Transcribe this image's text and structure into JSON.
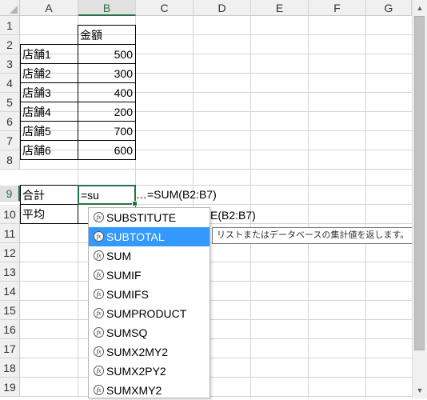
{
  "columns": [
    "A",
    "B",
    "C",
    "D",
    "E",
    "F",
    "G"
  ],
  "rows": [
    "1",
    "2",
    "3",
    "4",
    "5",
    "6",
    "7",
    "8",
    "9",
    "10",
    "11",
    "12",
    "13",
    "14",
    "15",
    "16",
    "17",
    "18",
    "19"
  ],
  "cells": {
    "B1": "金額",
    "A2": "店舗1",
    "B2": "500",
    "A3": "店舗2",
    "B3": "300",
    "A4": "店舗3",
    "B4": "400",
    "A5": "店舗4",
    "B5": "200",
    "A6": "店舗5",
    "B6": "700",
    "A7": "店舗6",
    "B7": "600",
    "A9": "合計",
    "B9": "=su",
    "C9": "…=SUM(B2:B7)",
    "A10": "平均",
    "C10_visible": "E(B2:B7)"
  },
  "autocomplete": {
    "items": [
      "SUBSTITUTE",
      "SUBTOTAL",
      "SUM",
      "SUMIF",
      "SUMIFS",
      "SUMPRODUCT",
      "SUMSQ",
      "SUMX2MY2",
      "SUMX2PY2",
      "SUMXMY2"
    ],
    "selected_index": 1,
    "tooltip": "リストまたはデータベースの集計値を返します。"
  },
  "icons": {
    "function": "fx-icon",
    "scroll_up": "▲",
    "scroll_down": "▼"
  },
  "colors": {
    "active_border": "#217346",
    "selection_highlight": "#3399ff"
  }
}
